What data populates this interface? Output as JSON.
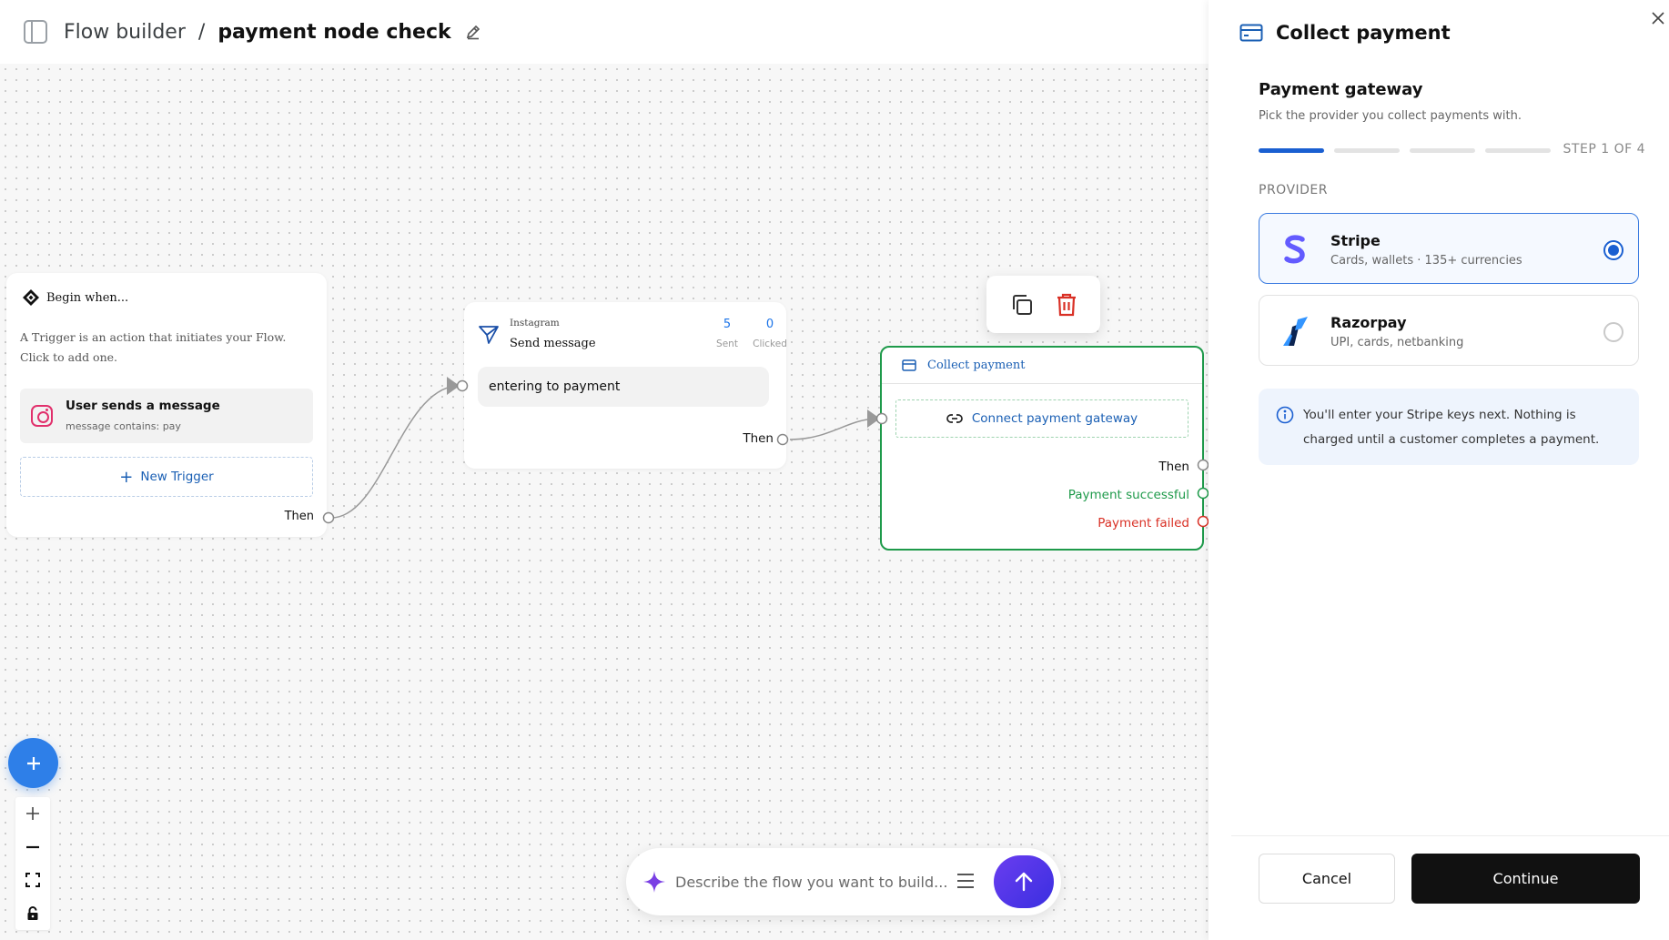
{
  "header": {
    "breadcrumb_root": "Flow builder",
    "breadcrumb_separator": "/",
    "breadcrumb_current": "payment node check"
  },
  "trigger_node": {
    "title": "Begin when...",
    "description": "A Trigger is an action that initiates your Flow. Click to add one.",
    "trigger_title": "User sends a message",
    "trigger_subtitle": "message contains: pay",
    "new_trigger_label": "New Trigger",
    "then_label": "Then"
  },
  "send_node": {
    "platform": "Instagram",
    "title": "Send message",
    "stats": [
      {
        "value": "5",
        "label": "Sent"
      },
      {
        "value": "0",
        "label": "Clicked"
      }
    ],
    "message": "entering to payment",
    "then_label": "Then"
  },
  "payment_node": {
    "title": "Collect payment",
    "connect_label": "Connect payment gateway",
    "outputs": {
      "then": "Then",
      "success": "Payment successful",
      "failed": "Payment failed"
    }
  },
  "chat": {
    "placeholder": "Describe the flow you want to build..."
  },
  "panel": {
    "title": "Collect payment",
    "section_title": "Payment gateway",
    "section_subtitle": "Pick the provider you collect payments with.",
    "step_label": "STEP 1 OF 4",
    "step_current": 1,
    "step_total": 4,
    "provider_label": "PROVIDER",
    "providers": [
      {
        "name": "Stripe",
        "description": "Cards, wallets · 135+ currencies",
        "selected": true
      },
      {
        "name": "Razorpay",
        "description": "UPI, cards, netbanking",
        "selected": false
      }
    ],
    "info_text": "You'll enter your Stripe keys next. Nothing is charged until a customer completes a payment.",
    "cancel_label": "Cancel",
    "continue_label": "Continue"
  },
  "colors": {
    "accent": "#1a5fd1",
    "success": "#1e9a4a",
    "danger": "#d93025",
    "stripe": "#635bff",
    "razorpay": "#0c2451"
  }
}
